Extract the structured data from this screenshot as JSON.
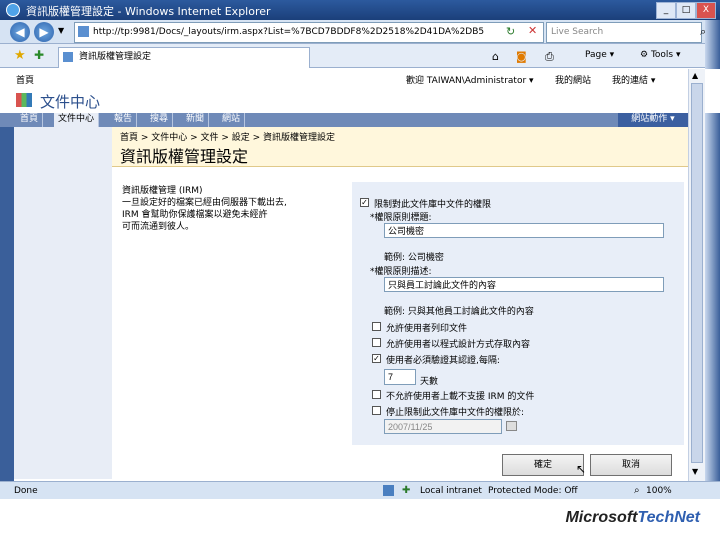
{
  "window": {
    "title": "資訊版權管理設定 - Windows Internet Explorer",
    "minimize": "_",
    "maximize": "□",
    "close": "X"
  },
  "address_bar": {
    "url": "http://tp:9981/Docs/_layouts/irm.aspx?List=%7BCD7BDDF8%2D2518%2D41DA%2DB5",
    "search_placeholder": "Live Search"
  },
  "tab": {
    "label": "資訊版權管理設定"
  },
  "toolbar": {
    "page": "Page",
    "tools": "Tools"
  },
  "sharepoint": {
    "top_left": "首頁",
    "welcome": "歡迎 TAIWAN\\Administrator",
    "my_site": "我的網站",
    "my_links": "我的連結",
    "site_title": "文件中心",
    "nav_tabs": [
      "首頁",
      "文件中心",
      "報告",
      "搜尋",
      "新聞",
      "網站"
    ],
    "active_tab_index": 1,
    "site_actions": "網站動作",
    "breadcrumb": "首頁 > 文件中心 > 文件 > 設定 > 資訊版權管理設定",
    "page_title": "資訊版權管理設定"
  },
  "form": {
    "section_title": "資訊版權管理 (IRM)",
    "section_desc": [
      "一旦設定好的檔案已經由伺服器下載出去,",
      "IRM 會幫助你保護檔案以避免未經許",
      "可而流通到彼人。"
    ],
    "restrict_label": "限制對此文件庫中文件的權限",
    "policy_title_label": "*權限原則標題:",
    "policy_title_value": "公司機密",
    "policy_title_example": "範例: 公司機密",
    "policy_desc_label": "*權限原則描述:",
    "policy_desc_value": "只與員工討論此文件的內容",
    "policy_desc_example": "範例: 只與其他員工討論此文件的內容",
    "options": [
      {
        "label": "允許使用者列印文件",
        "checked": false
      },
      {
        "label": "允許使用者以程式設計方式存取內容",
        "checked": false
      },
      {
        "label": "使用者必須驗證其認證,每隔:",
        "checked": true
      }
    ],
    "days_value": "7",
    "days_unit": "天數",
    "option_no_irm": "不允許使用者上載不支援 IRM 的文件",
    "option_stop_date": "停止限制此文件庫中文件的權限於:",
    "date_value": "2007/11/25",
    "ok_button": "確定",
    "cancel_button": "取消"
  },
  "status": {
    "left": "Done",
    "zone": "Local intranet",
    "protected_mode": "Protected Mode: Off",
    "zoom": "100%"
  },
  "footer": {
    "brand_ms": "Microsoft",
    "brand_tn": "TechNet"
  }
}
